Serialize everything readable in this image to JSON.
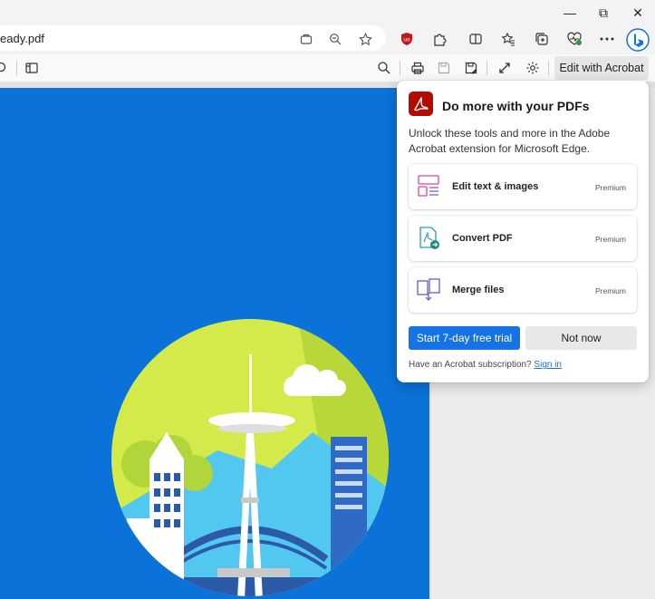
{
  "window": {
    "controls": {
      "minimize": "—",
      "maximize": "⧉",
      "close": "✕"
    }
  },
  "address_bar": {
    "url_text": "eady.pdf"
  },
  "pdf_toolbar": {
    "edit_with_acrobat": "Edit with Acrobat"
  },
  "popup": {
    "title": "Do more with your PDFs",
    "description": "Unlock these tools and more in the Adobe Acrobat extension for Microsoft Edge.",
    "features": [
      {
        "label": "Edit text & images",
        "badge": "Premium",
        "icon": "edit-text-images-icon"
      },
      {
        "label": "Convert PDF",
        "badge": "Premium",
        "icon": "convert-pdf-icon"
      },
      {
        "label": "Merge files",
        "badge": "Premium",
        "icon": "merge-files-icon"
      }
    ],
    "primary_button": "Start 7-day free trial",
    "secondary_button": "Not now",
    "footer_text": "Have an Acrobat subscription?",
    "footer_link": "Sign in"
  },
  "colors": {
    "accent_blue": "#1473e6",
    "acrobat_red": "#b30b00",
    "page_blue": "#0a72d8",
    "lime": "#d3ea4a"
  }
}
